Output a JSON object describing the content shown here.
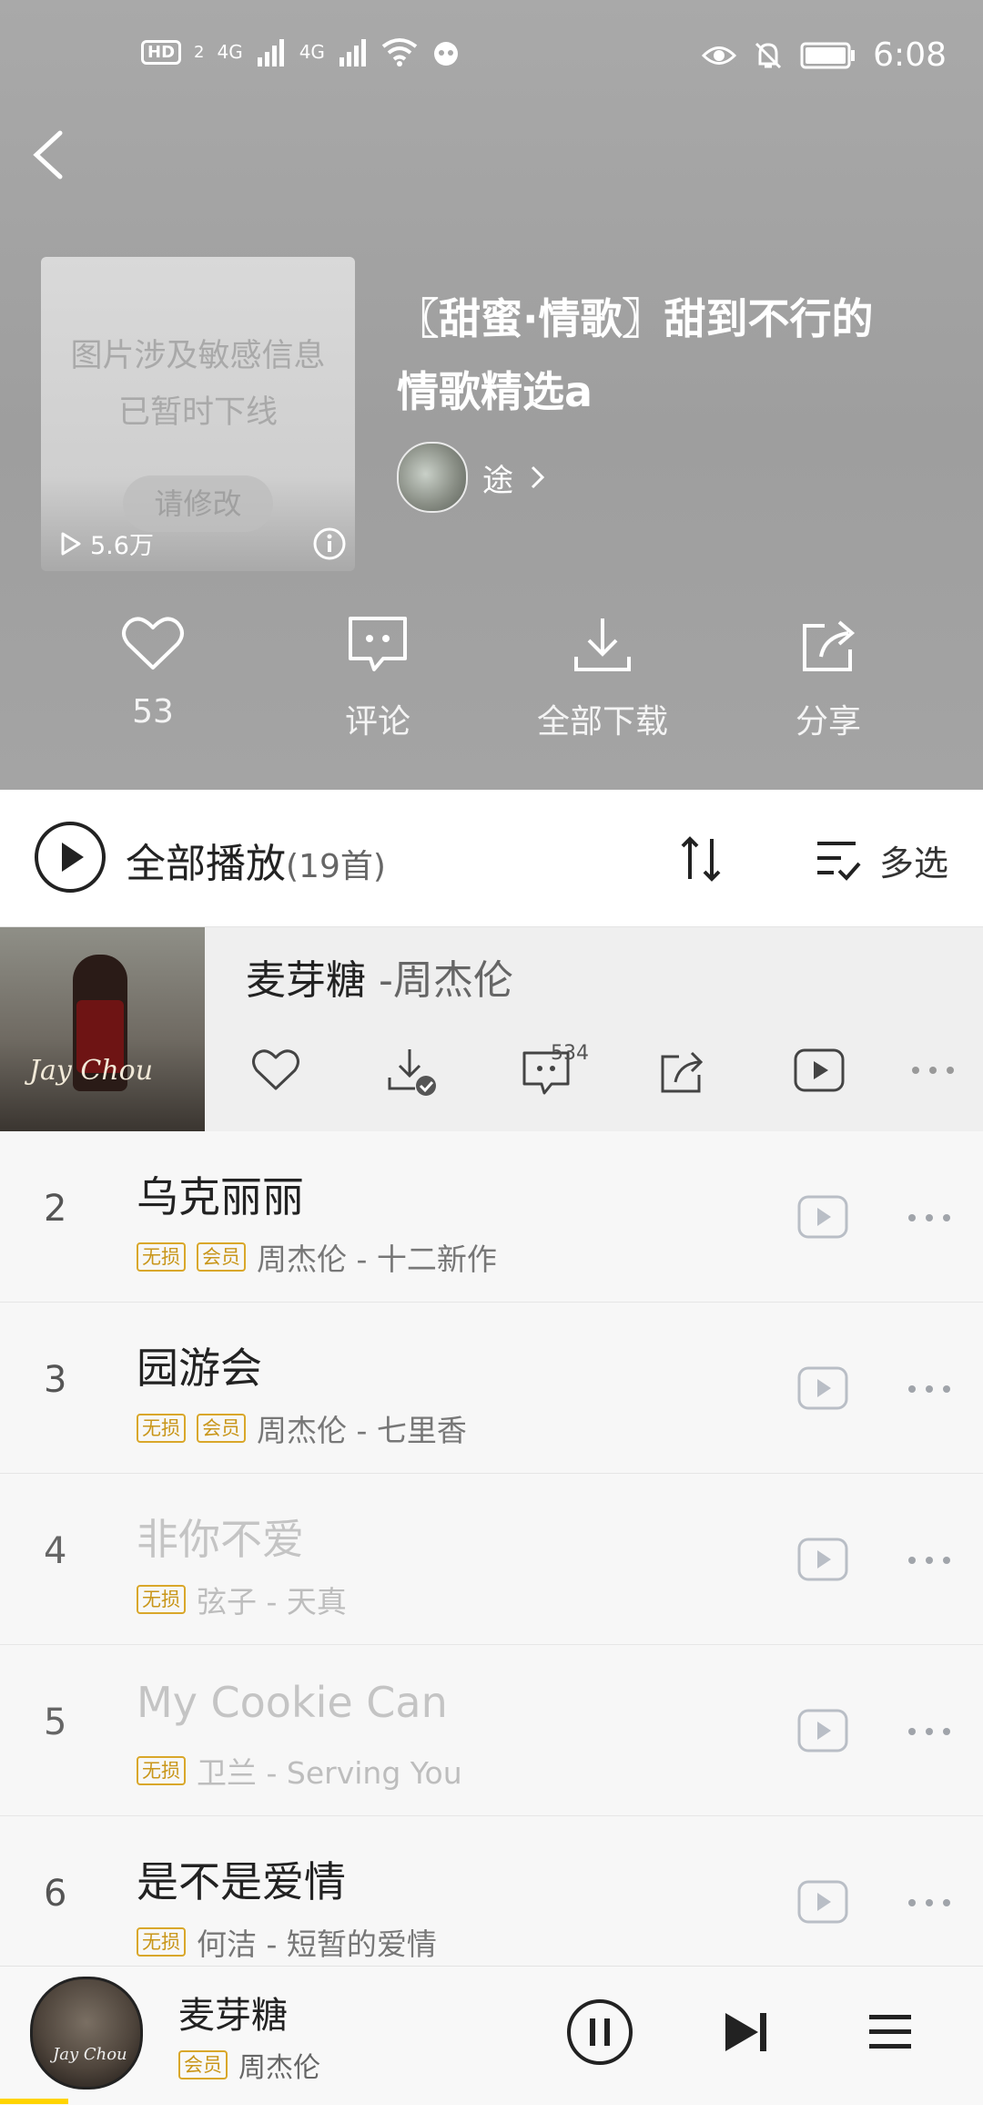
{
  "status_bar": {
    "hd": "HD",
    "sim": "2",
    "net1": "4G",
    "net2": "4G",
    "time": "6:08"
  },
  "playlist": {
    "title_line1": "〖甜蜜·情歌〗甜到不行的",
    "title_line2": "情歌精选a",
    "owner_name": "途",
    "cover_notice_line1": "图片涉及敏感信息",
    "cover_notice_line2": "已暂时下线",
    "cover_fix_button": "请修改",
    "play_count": "5.6万"
  },
  "actions": {
    "like_count": "53",
    "comment_label": "评论",
    "download_label": "全部下载",
    "share_label": "分享"
  },
  "list_header": {
    "play_all_label": "全部播放",
    "count_label": "(19首)",
    "multi_select_label": "多选"
  },
  "current_song": {
    "title": "麦芽糖",
    "artist": " -周杰伦",
    "comment_count": "534",
    "art_text": "Jay Chou"
  },
  "songs": [
    {
      "index": "2",
      "title": "乌克丽丽",
      "tags": [
        "无损",
        "会员"
      ],
      "subtitle": "周杰伦 - 十二新作",
      "dimmed": false
    },
    {
      "index": "3",
      "title": "园游会",
      "tags": [
        "无损",
        "会员"
      ],
      "subtitle": "周杰伦 - 七里香",
      "dimmed": false
    },
    {
      "index": "4",
      "title": "非你不爱",
      "tags": [
        "无损"
      ],
      "subtitle": "弦子 - 天真",
      "dimmed": true
    },
    {
      "index": "5",
      "title": "My Cookie Can",
      "tags": [
        "无损"
      ],
      "subtitle": "卫兰 - Serving You",
      "dimmed": true
    },
    {
      "index": "6",
      "title": "是不是爱情",
      "tags": [
        "无损"
      ],
      "subtitle": "何洁 - 短暂的爱情",
      "dimmed": false
    }
  ],
  "mini_player": {
    "song": "麦芽糖",
    "tag": "会员",
    "artist": "周杰伦",
    "disc_text": "Jay Chou"
  },
  "colors": {
    "header_bg": "#a4a4a4",
    "tag_gold": "#d9a72a",
    "progress": "#ffd400"
  }
}
